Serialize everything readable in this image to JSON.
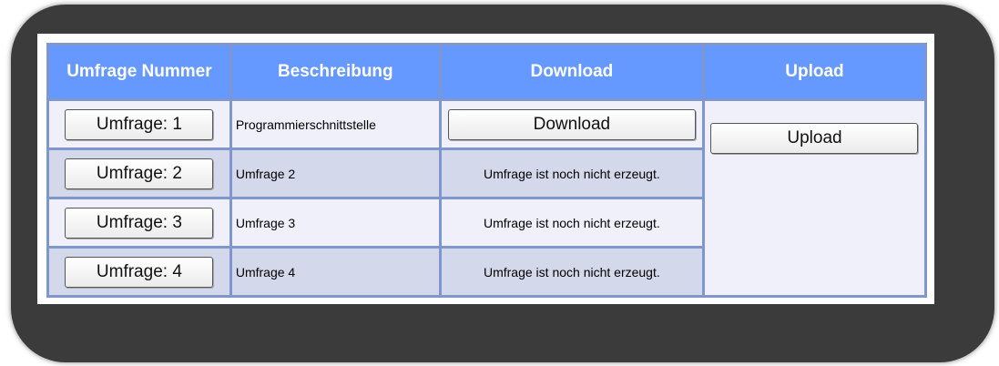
{
  "table": {
    "headers": {
      "survey_number": "Umfrage Nummer",
      "description": "Beschreibung",
      "download": "Download",
      "upload": "Upload"
    },
    "rows": [
      {
        "survey_button": "Umfrage: 1",
        "description": "Programmierschnittstelle",
        "download_button": "Download",
        "download_status": ""
      },
      {
        "survey_button": "Umfrage: 2",
        "description": "Umfrage 2",
        "download_button": "",
        "download_status": "Umfrage ist noch nicht erzeugt."
      },
      {
        "survey_button": "Umfrage: 3",
        "description": "Umfrage 3",
        "download_button": "",
        "download_status": "Umfrage ist noch nicht erzeugt."
      },
      {
        "survey_button": "Umfrage: 4",
        "description": "Umfrage 4",
        "download_button": "",
        "download_status": "Umfrage ist noch nicht erzeugt."
      }
    ],
    "upload_button": "Upload"
  },
  "colors": {
    "frame": "#3b3b3b",
    "header_bg": "#6699ff",
    "header_text": "#ffffff",
    "grid": "#7f97cc",
    "row_light": "#f0f0fa",
    "row_dark": "#d3d9ea"
  }
}
